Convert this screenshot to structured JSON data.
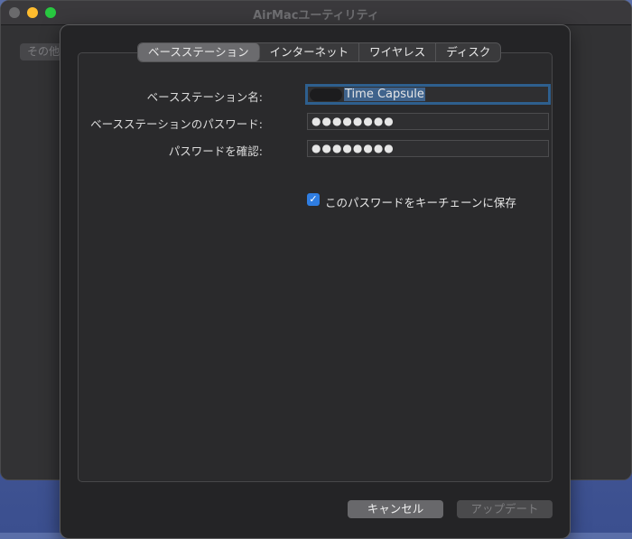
{
  "window": {
    "title": "AirMacユーティリティ",
    "other_button": "その他"
  },
  "tabs": [
    {
      "label": "ベースステーション",
      "active": true
    },
    {
      "label": "インターネット",
      "active": false
    },
    {
      "label": "ワイヤレス",
      "active": false
    },
    {
      "label": "ディスク",
      "active": false
    }
  ],
  "form": {
    "name_label": "ベースステーション名:",
    "name_value": "Time Capsule",
    "password_label": "ベースステーションのパスワード:",
    "password_value": "●●●●●●●●",
    "confirm_label": "パスワードを確認:",
    "confirm_value": "●●●●●●●●",
    "keychain_checked": true,
    "keychain_label": "このパスワードをキーチェーンに保存"
  },
  "buttons": {
    "cancel": "キャンセル",
    "update": "アップデート"
  },
  "colors": {
    "accent": "#2f7de1",
    "sheet_bg": "#242426",
    "focus_ring": "#2e5f8e"
  },
  "icons": {
    "checkbox": "checkmark-icon"
  }
}
